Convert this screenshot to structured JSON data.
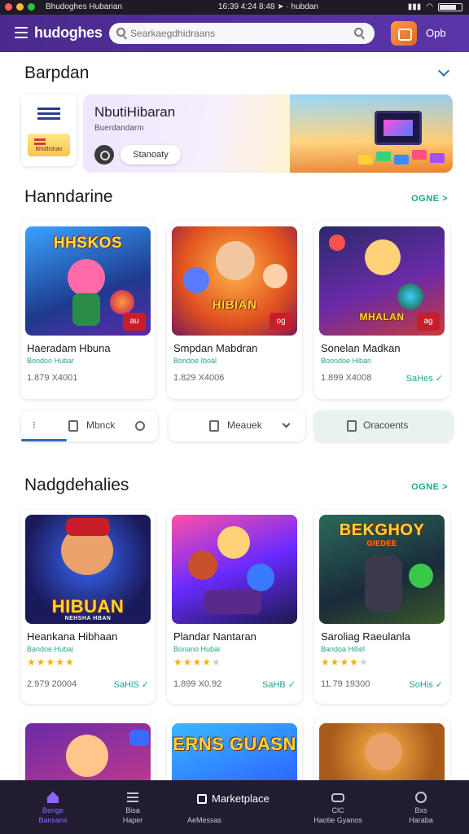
{
  "status_bar": {
    "app_name": "Bhudoghes Hubarian",
    "time": "16:39 4:24 8:48 ➤ · hubdan"
  },
  "header": {
    "brand": "hudoghes",
    "search_placeholder": "Searkaegdhidraans",
    "user_label": "Opb"
  },
  "banner_section": {
    "title": "Barpdan",
    "flag_label": "Bhidhshan",
    "hero": {
      "title": "NbutiHibaran",
      "subtitle": "Buerdandarm",
      "button": "Stanoaty"
    }
  },
  "section1": {
    "title": "Hanndarine",
    "see_more": "OGNE >",
    "cards": [
      {
        "art": "HHSKOS",
        "badge": "au",
        "name": "Haeradam Hbuna",
        "sub": "Bondoo Hubar",
        "stat": "1.879 X4001",
        "link": ""
      },
      {
        "art": "HIBIAN",
        "badge": "og",
        "name": "Smpdan Mabdran",
        "sub": "Bondoe Iboal",
        "stat": "1.829 X4006",
        "link": ""
      },
      {
        "art": "MHALAN",
        "badge": "ag",
        "name": "Sonelan Madkan",
        "sub": "Boondoe Hiban",
        "stat": "1.899 X4008",
        "link": "SaHes ✓"
      }
    ]
  },
  "actions": {
    "pill1_label": "Mbnck",
    "pill2_label": "Meauek",
    "pill3_label": "Oracoents"
  },
  "section2": {
    "title": "Nadgdehalies",
    "see_more": "OGNE >",
    "cards": [
      {
        "art": "HIBUAN",
        "caption": "NEHSHA HBAN",
        "name": "Heankana Hibhaan",
        "sub": "Bandoe Hubai",
        "rating": 4.5,
        "stat": "2.979 20004",
        "link": "SaHiS ✓"
      },
      {
        "art": "",
        "caption": "",
        "name": "Plandar Nantaran",
        "sub": "Bonano Hubai",
        "rating": 3.5,
        "stat": "1.899 X0.92",
        "link": "SaHB ✓"
      },
      {
        "art": "BEKGHOY",
        "caption": "GIEDEE",
        "name": "Saroliag Raeulanla",
        "sub": "Bandoa Hibel",
        "rating": 4.0,
        "stat": "11.79 19300",
        "link": "SoHis ✓"
      }
    ]
  },
  "section3": {
    "cards": [
      {
        "art": ""
      },
      {
        "art": "ERNS GUASN"
      },
      {
        "art": ""
      }
    ]
  },
  "bottom_nav": {
    "items": [
      {
        "top": "Benge",
        "label": "Bansans",
        "active": true
      },
      {
        "top": "Bisa",
        "label": "Haper",
        "active": false
      },
      {
        "top": "",
        "label": "AeMessas",
        "active": false
      },
      {
        "top": "ClC",
        "label": "Haotie Gyanos",
        "active": false
      },
      {
        "top": "Bxs",
        "label": "Haraba",
        "active": false
      }
    ],
    "marketplace": "Marketplace"
  },
  "colors": {
    "brand_purple": "#5b35a8",
    "accent_teal": "#21a38f",
    "badge_red": "#c81e2a",
    "star_gold": "#f4b400",
    "nav_bg": "#221c30"
  }
}
